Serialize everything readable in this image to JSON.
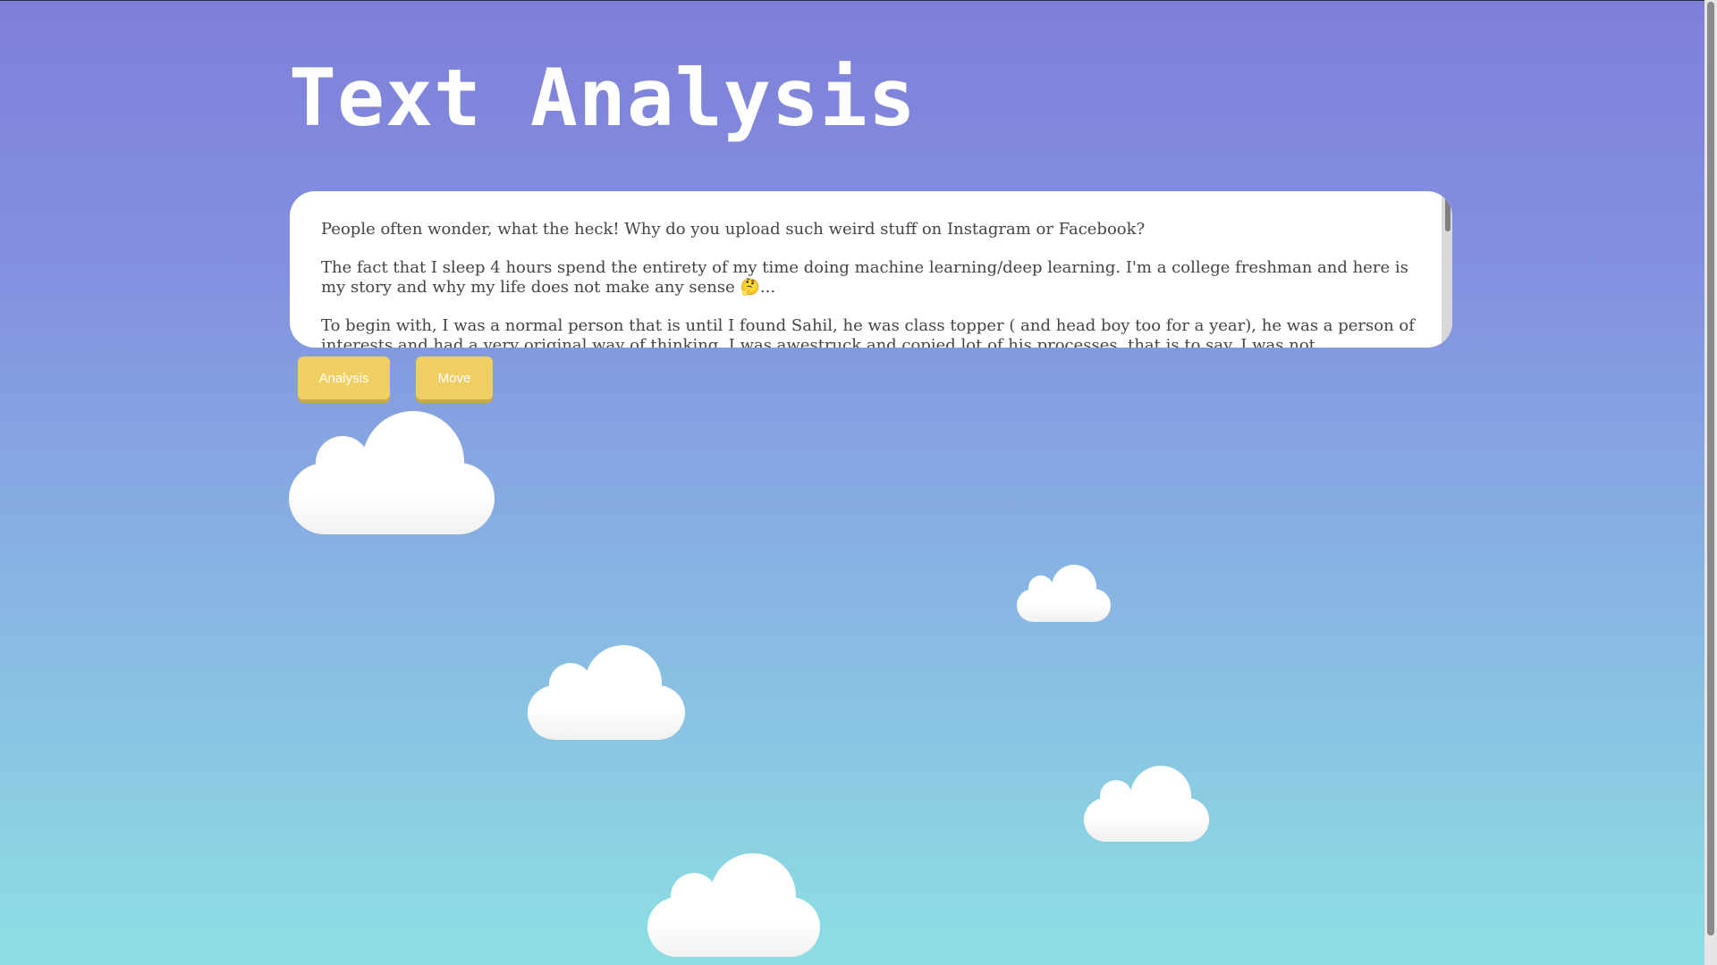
{
  "page": {
    "title": "Text Analysis"
  },
  "textarea": {
    "paragraphs": [
      "People often wonder, what the heck! Why do you upload such weird stuff on Instagram or Facebook?",
      "The fact that I sleep 4 hours spend the entirety of my time doing machine learning/deep learning. I'm a college freshman and here is my story and why my life does not make any sense 🤔...",
      "To begin with, I was a normal person that is until I found Sahil, he was class topper ( and head boy too for a year), he was a person of interests and had a very original way of thinking. I was awestruck and copied lot of his processes, that is to say, I was not"
    ]
  },
  "buttons": {
    "analysis_label": "Analysis",
    "move_label": "Move"
  },
  "colors": {
    "background_top": "#7f7fd9",
    "background_bottom": "#8ddfe3",
    "button": "#efcf62",
    "button_text": "#ffffff"
  }
}
